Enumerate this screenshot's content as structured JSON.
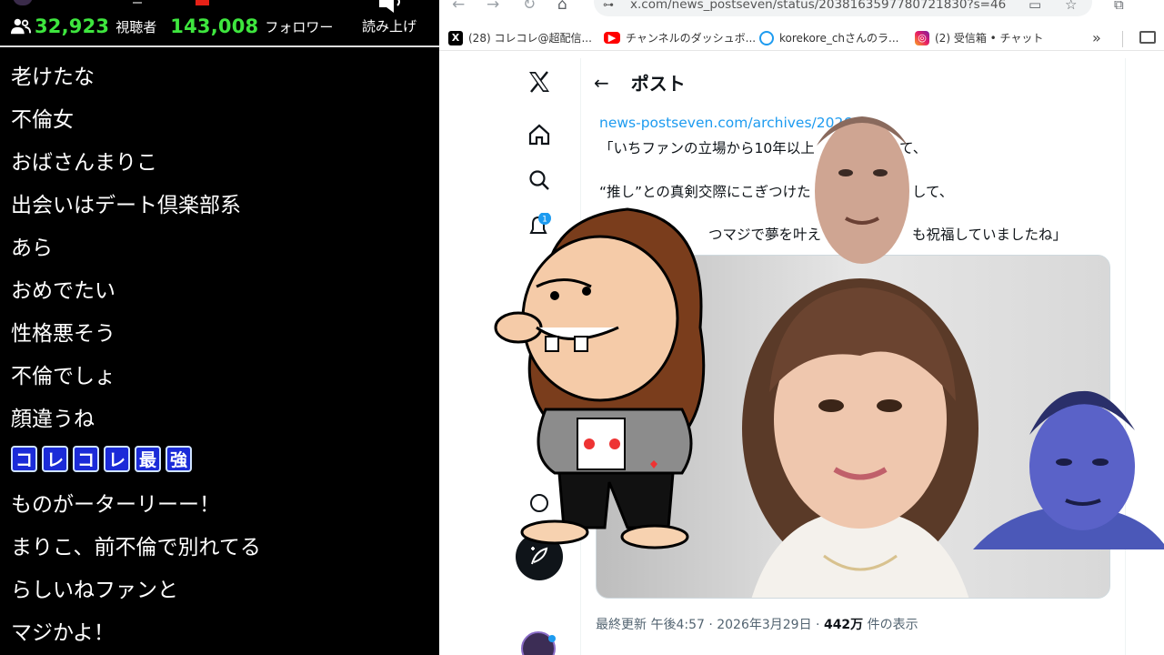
{
  "stream": {
    "viewer_count": "32,923",
    "viewer_label": "視聴者",
    "follower_count": "143,008",
    "follower_label": "フォロワー",
    "read_aloud_label": "読み上げ",
    "comments": [
      "老けたな",
      "不倫女",
      "おばさんまりこ",
      "出会いはデート倶楽部系",
      "あら",
      "おめでたい",
      "性格悪そう",
      "不倫でしょ",
      "顔違うね",
      null,
      "ものがーターリーー！",
      "まりこ、前不倫で別れてる",
      "らしいねファンと",
      "マジかよ！"
    ],
    "decorated_comment": [
      "コ",
      "レ",
      "コ",
      "レ",
      "最",
      "強"
    ],
    "colors": {
      "panel_bg": "#000000",
      "count_green": "#3ee63e",
      "deco_blue": "#1b2bd8"
    }
  },
  "browser": {
    "url": "x.com/news_postseven/status/2038163597780721830?s=46",
    "bookmarks": [
      {
        "label": "(28) コレコレ@超配信...",
        "icon": "x-logo-icon"
      },
      {
        "label": "チャンネルのダッシュボ...",
        "icon": "youtube-icon"
      },
      {
        "label": "korekore_chさんのラ...",
        "icon": "twitcasting-icon"
      },
      {
        "label": "(2) 受信箱 • チャット",
        "icon": "instagram-icon"
      }
    ],
    "nav_badge": "1"
  },
  "post": {
    "header_title": "ポスト",
    "link_text": "news-postseven.com/archives/2026",
    "line1": "「いちファンの立場から10年以上",
    "line1_tail": "て、",
    "line2": "“推し”との真剣交際にこぎつけた",
    "line2_tail": "して、",
    "line3": "つマジで夢を叶え",
    "line3_tail": "も祝福していましたね」",
    "meta_prefix": "最終更新 午後4:57 · 2026年3月29日 · ",
    "views_count": "442万",
    "views_suffix": " 件の表示"
  }
}
